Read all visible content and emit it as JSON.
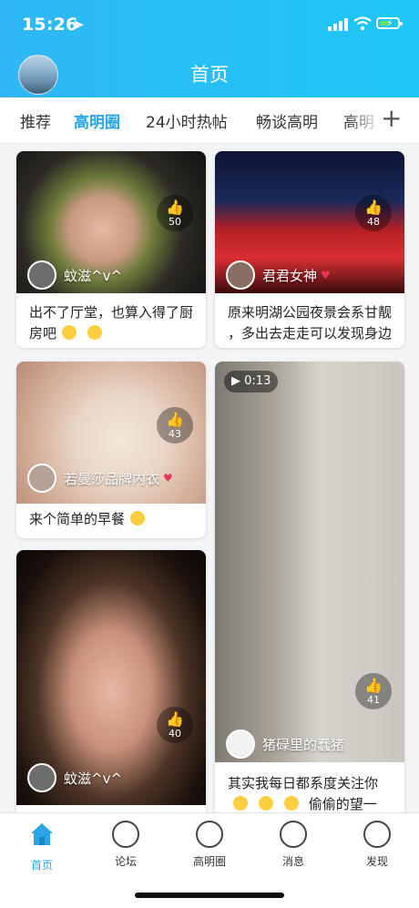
{
  "status_bar": {
    "time": "15:26",
    "location_glyph": "➤"
  },
  "header": {
    "title": "首页"
  },
  "tabs": [
    {
      "label": "推荐"
    },
    {
      "label": "高明圈",
      "active": true
    },
    {
      "label": "24小时热帖"
    },
    {
      "label": "畅谈高明"
    },
    {
      "label": "高明"
    }
  ],
  "tabs_add_label": "+",
  "feed": {
    "cards": [
      {
        "likes": "50",
        "author": "蚊滋^v^",
        "caption_1": "出不了厅堂，也算入得了厨",
        "caption_2": "房吧"
      },
      {
        "likes": "48",
        "author": "君君女神",
        "caption_1": "原来明湖公园夜景会系甘靓",
        "caption_2": "，多出去走走可以发现身边"
      },
      {
        "likes": "43",
        "author": "若曼莎品牌内衣",
        "caption_1": "来个简单的早餐"
      },
      {
        "likes": "41",
        "author": "猪碌里的蠢猪",
        "video_time": "0:13",
        "caption_1": "其实我每日都系度关注你",
        "caption_2": "偷偷的望一"
      },
      {
        "likes": "40",
        "author": "蚊滋^v^"
      }
    ]
  },
  "bottom_nav": [
    {
      "label": "首页",
      "icon": "home-icon",
      "active": true
    },
    {
      "label": "论坛",
      "icon": "forum-icon"
    },
    {
      "label": "高明圈",
      "icon": "circle-icon"
    },
    {
      "label": "消息",
      "icon": "message-icon"
    },
    {
      "label": "发现",
      "icon": "rocket-icon"
    }
  ],
  "colors": {
    "accent": "#2aa6e6",
    "header_start": "#2fb7f5",
    "header_end": "#1ec7f6"
  }
}
